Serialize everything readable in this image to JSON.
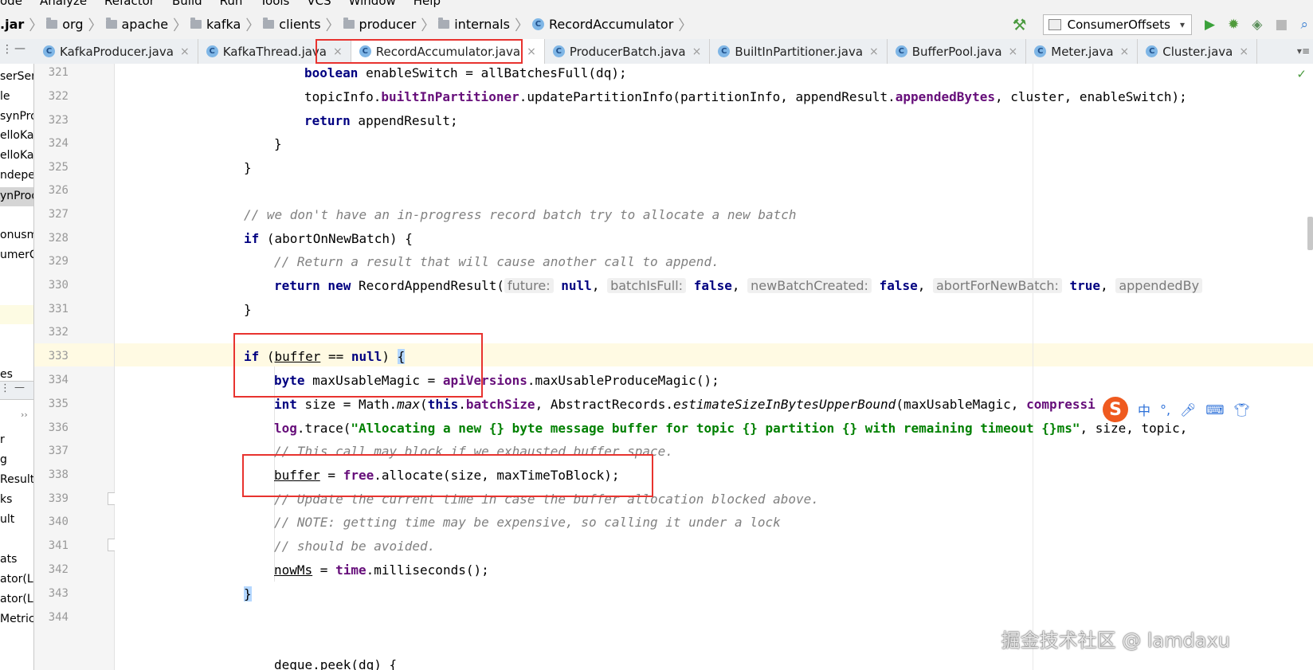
{
  "menubar": {
    "items": [
      "ode",
      "Analyze",
      "Refactor",
      "Build",
      "Run",
      "Tools",
      "VCS",
      "Window",
      "Help"
    ]
  },
  "breadcrumb": {
    "items": [
      {
        "label": ".jar",
        "icon": "none"
      },
      {
        "label": "org",
        "icon": "folder-icon"
      },
      {
        "label": "apache",
        "icon": "folder-icon"
      },
      {
        "label": "kafka",
        "icon": "folder-icon"
      },
      {
        "label": "clients",
        "icon": "folder-icon"
      },
      {
        "label": "producer",
        "icon": "folder-icon"
      },
      {
        "label": "internals",
        "icon": "folder-icon"
      },
      {
        "label": "RecordAccumulator",
        "icon": "class-icon"
      }
    ]
  },
  "run_config": {
    "label": "ConsumerOffsets"
  },
  "tabs": [
    {
      "label": "KafkaProducer.java",
      "active": false
    },
    {
      "label": "KafkaThread.java",
      "active": false
    },
    {
      "label": "RecordAccumulator.java",
      "active": true
    },
    {
      "label": "ProducerBatch.java",
      "active": false
    },
    {
      "label": "BuiltInPartitioner.java",
      "active": false
    },
    {
      "label": "BufferPool.java",
      "active": false
    },
    {
      "label": "Meter.java",
      "active": false
    },
    {
      "label": "Cluster.java",
      "active": false
    }
  ],
  "project_panel": {
    "items": [
      "serSer",
      "le",
      "synPro",
      "elloKa",
      "elloKa",
      "ndeper",
      "ynProd",
      "onusm",
      "umerC",
      "es",
      "r",
      "g",
      "Result",
      "ks",
      "ult",
      "ats",
      "ator(L",
      "ator(L",
      "Metric"
    ]
  },
  "code": {
    "line_numbers": [
      "321",
      "322",
      "323",
      "324",
      "325",
      "326",
      "327",
      "328",
      "329",
      "330",
      "331",
      "332",
      "333",
      "334",
      "335",
      "336",
      "337",
      "338",
      "339",
      "340",
      "341",
      "342",
      "343",
      "344"
    ],
    "tokens": {
      "l321_kw": "boolean",
      "l321_a": " enableSwitch = allBatchesFull(dq);",
      "l322_a": "topicInfo.",
      "l322_f": "builtInPartitioner",
      "l322_b": ".updatePartitionInfo(partitionInfo, appendResult.",
      "l322_f2": "appendedBytes",
      "l322_c": ", cluster, enableSwitch);",
      "l323_kw": "return",
      "l323_a": " appendResult;",
      "l324": "}",
      "l325": "}",
      "l327": "// we don't have an in-progress record batch try to allocate a new batch",
      "l328_kw": "if",
      "l328_a": " (abortOnNewBatch) {",
      "l329": "// Return a result that will cause another call to append.",
      "l330_kw": "return new",
      "l330_a": " RecordAppendResult(",
      "l330_h1": "future:",
      "l330_v1": "null",
      "l330_h2": "batchIsFull:",
      "l330_v2": "false",
      "l330_h3": "newBatchCreated:",
      "l330_v3": "false",
      "l330_h4": "abortForNewBatch:",
      "l330_v4": "true",
      "l330_h5": "appendedBy",
      "l331": "}",
      "l333_kw": "if",
      "l333_a": " (",
      "l333_u": "buffer",
      "l333_b": " == ",
      "l333_kw2": "null",
      "l333_c": ") ",
      "l333_brace": "{",
      "l334_kw": "byte",
      "l334_a": " maxUsableMagic = ",
      "l334_f": "apiVersions",
      "l334_b": ".maxUsableProduceMagic();",
      "l335_kw": "int",
      "l335_a": " size = Math.",
      "l335_i": "max",
      "l335_b": "(",
      "l335_kw2": "this",
      "l335_c": ".",
      "l335_f": "batchSize",
      "l335_d": ", AbstractRecords.",
      "l335_i2": "estimateSizeInBytesUpperBound",
      "l335_e": "(maxUsableMagic, ",
      "l335_f2": "compressi",
      "l336_f": "log",
      "l336_a": ".trace(",
      "l336_s": "\"Allocating a new {} byte message buffer for topic {} partition {} with remaining timeout {}ms\"",
      "l336_b": ", size, topic,",
      "l337": "// This call may block if we exhausted buffer space.",
      "l338_u": "buffer",
      "l338_a": " = ",
      "l338_f": "free",
      "l338_b": ".allocate(size, maxTimeToBlock);",
      "l339": "// Update the current time in case the buffer allocation blocked above.",
      "l340": "// NOTE: getting time may be expensive, so calling it under a lock",
      "l341": "// should be avoided.",
      "l342_u": "nowMs",
      "l342_a": " = ",
      "l342_f": "time",
      "l342_b": ".milliseconds();",
      "l343": "}",
      "l345": "deque.peek(dq) {"
    }
  },
  "ime": {
    "logo": "S",
    "buttons": [
      "中",
      "°,",
      "mic-icon",
      "keyboard-icon",
      "shirt-icon"
    ]
  },
  "watermark": "掘金技术社区 @ lamdaxu",
  "colors": {
    "keyword": "#000080",
    "field": "#660e7a",
    "string": "#008000",
    "comment": "#808080",
    "highlight_box": "#e8332f",
    "current_line": "#fffae3"
  }
}
